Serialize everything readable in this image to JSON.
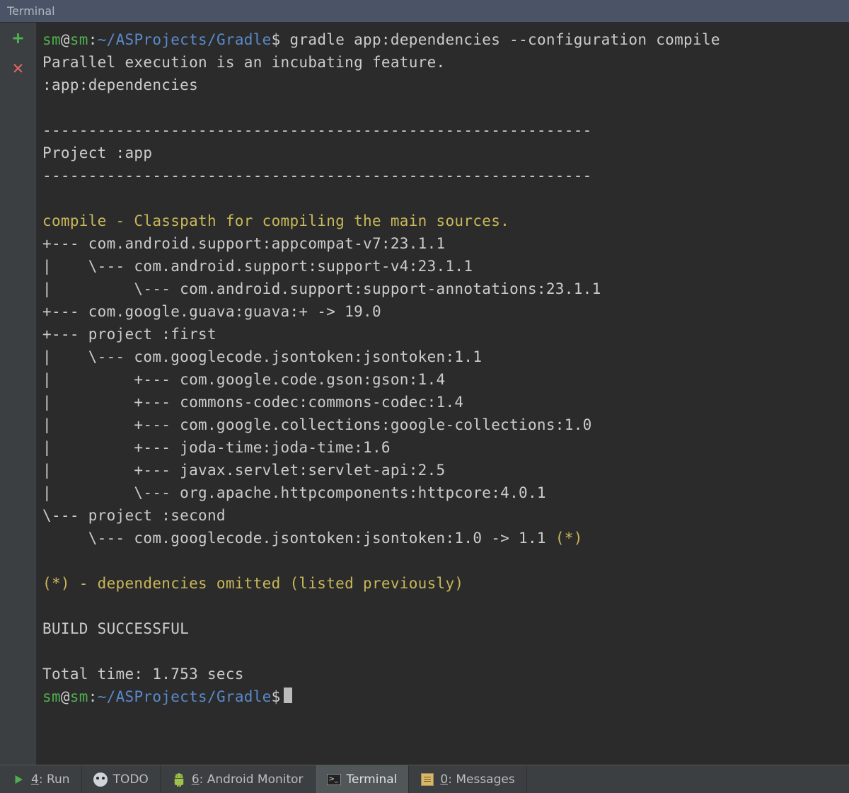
{
  "titlebar": {
    "label": "Terminal"
  },
  "gutter": {
    "add_tooltip": "New Session",
    "close_tooltip": "Close Session"
  },
  "prompt": {
    "user": "sm",
    "at": "@",
    "host": "sm",
    "colon": ":",
    "path": "~/ASProjects/Gradle",
    "dollar": "$"
  },
  "command": " gradle app:dependencies --configuration compile",
  "lines": {
    "parallel": "Parallel execution is an incubating feature.",
    "task": ":app:dependencies",
    "rule": "------------------------------------------------------------",
    "project": "Project :app",
    "config": "compile - Classpath for compiling the main sources.",
    "d1": "+--- com.android.support:appcompat-v7:23.1.1",
    "d2": "|    \\--- com.android.support:support-v4:23.1.1",
    "d3": "|         \\--- com.android.support:support-annotations:23.1.1",
    "d4": "+--- com.google.guava:guava:+ -> 19.0",
    "d5": "+--- project :first",
    "d6": "|    \\--- com.googlecode.jsontoken:jsontoken:1.1",
    "d7": "|         +--- com.google.code.gson:gson:1.4",
    "d8": "|         +--- commons-codec:commons-codec:1.4",
    "d9": "|         +--- com.google.collections:google-collections:1.0",
    "d10": "|         +--- joda-time:joda-time:1.6",
    "d11": "|         +--- javax.servlet:servlet-api:2.5",
    "d12": "|         \\--- org.apache.httpcomponents:httpcore:4.0.1",
    "d13": "\\--- project :second",
    "d14_pre": "     \\--- com.googlecode.jsontoken:jsontoken:1.0 -> 1.1 ",
    "d14_star": "(*)",
    "omitted": "(*) - dependencies omitted (listed previously)",
    "build": "BUILD SUCCESSFUL",
    "total": "Total time: 1.753 secs"
  },
  "bottombar": {
    "run_num": "4",
    "run_label": ": Run",
    "todo_label": "TODO",
    "android_num": "6",
    "android_label": ": Android Monitor",
    "terminal_label": "Terminal",
    "messages_num": "0",
    "messages_label": ": Messages"
  }
}
